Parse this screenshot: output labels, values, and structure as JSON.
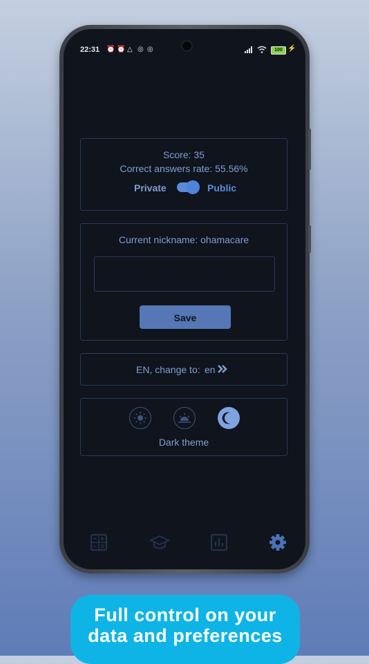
{
  "status_bar": {
    "time": "22:31",
    "battery": "100"
  },
  "stats": {
    "score": "Score: 35",
    "correct_rate": "Correct answers rate: 55.56%",
    "private_label": "Private",
    "public_label": "Public",
    "public_enabled": true
  },
  "nickname": {
    "current": "Current nickname: ohamacare",
    "input_value": "",
    "save_label": "Save"
  },
  "language": {
    "label": "EN, change to:",
    "target": "en"
  },
  "theme": {
    "options": [
      "light-theme-icon",
      "auto-theme-icon",
      "dark-theme-icon"
    ],
    "selected": "dark",
    "label": "Dark theme"
  },
  "nav": {
    "items": [
      "calculator-icon",
      "graduation-cap-icon",
      "bar-chart-icon",
      "gear-icon"
    ],
    "active": "gear-icon"
  },
  "caption": {
    "line1": "Full control on your",
    "line2": "data and preferences"
  },
  "colors": {
    "accent": "#5b8ad8",
    "text": "#7f9fd0",
    "background": "#0f141d",
    "caption_bg": "#0fb4e6"
  }
}
